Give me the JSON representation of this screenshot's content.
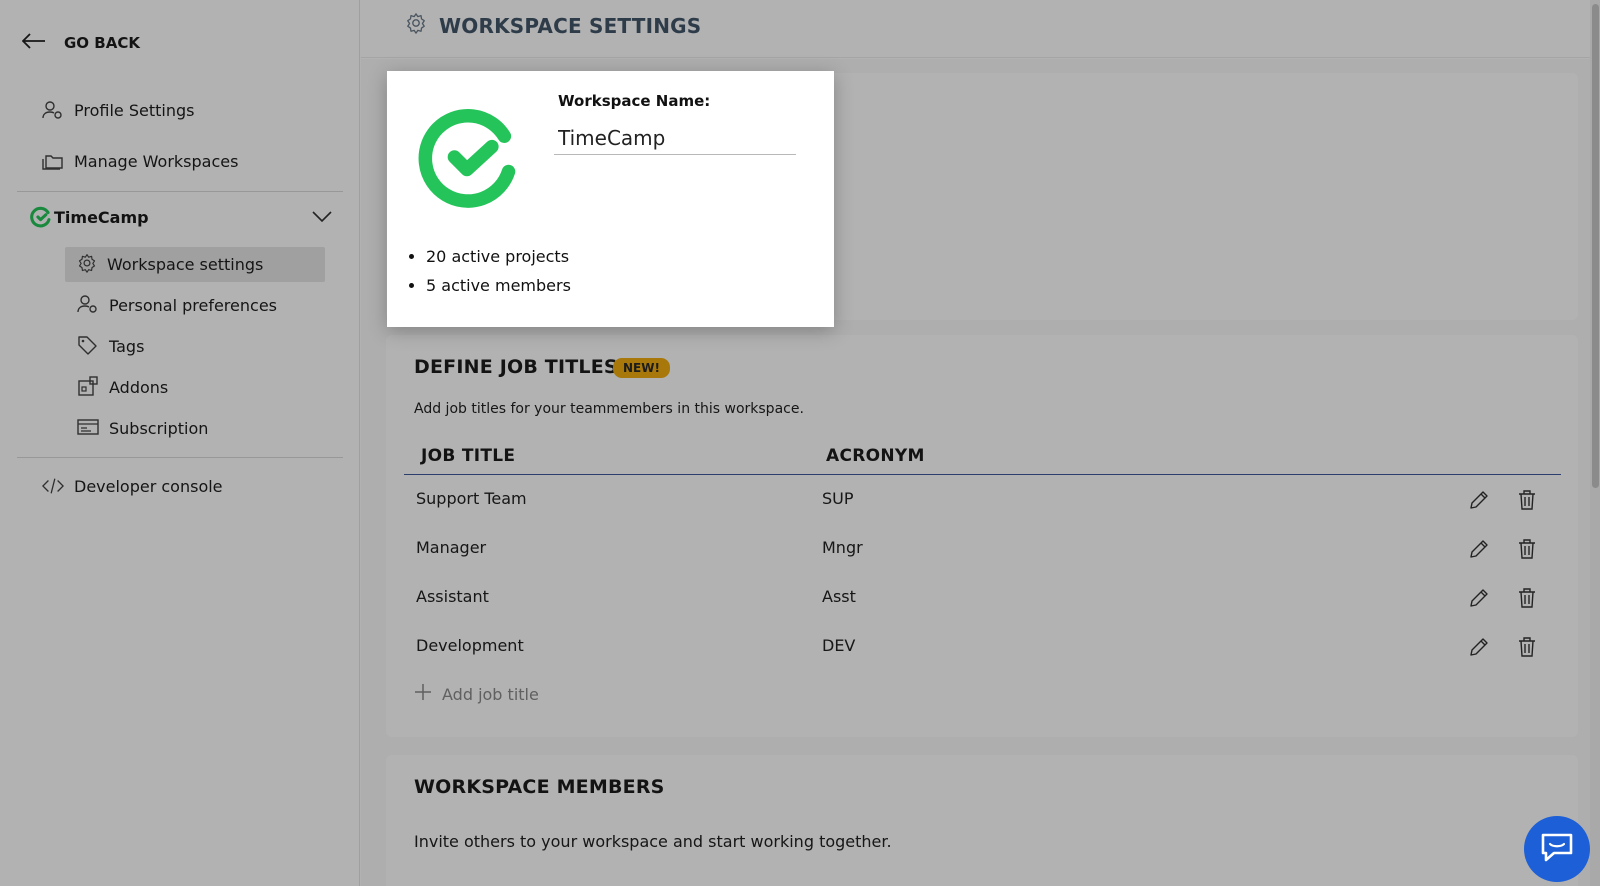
{
  "sidebar": {
    "go_back": "GO BACK",
    "profile_settings": "Profile Settings",
    "manage_workspaces": "Manage Workspaces",
    "workspace_name": "TimeCamp",
    "sub_items": [
      {
        "label": "Workspace settings",
        "icon": "gear-icon",
        "active": true
      },
      {
        "label": "Personal preferences",
        "icon": "user-gear-icon",
        "active": false
      },
      {
        "label": "Tags",
        "icon": "tag-icon",
        "active": false
      },
      {
        "label": "Addons",
        "icon": "addons-icon",
        "active": false
      },
      {
        "label": "Subscription",
        "icon": "card-icon",
        "active": false
      }
    ],
    "developer_console": "Developer console"
  },
  "topbar": {
    "title": "WORKSPACE SETTINGS"
  },
  "job_titles": {
    "title": "DEFINE JOB TITLES",
    "badge": "NEW!",
    "description": "Add job titles for your teammembers in this workspace.",
    "col_title": "JOB TITLE",
    "col_acronym": "ACRONYM",
    "rows": [
      {
        "title": "Support Team",
        "acronym": "SUP"
      },
      {
        "title": "Manager",
        "acronym": "Mngr"
      },
      {
        "title": "Assistant",
        "acronym": "Asst"
      },
      {
        "title": "Development",
        "acronym": "DEV"
      }
    ],
    "add_label": "Add job title"
  },
  "members": {
    "title": "WORKSPACE MEMBERS",
    "description": "Invite others to your workspace and start working together."
  },
  "popup": {
    "label": "Workspace Name:",
    "value": "TimeCamp",
    "stats": [
      "20 active projects",
      "5 active members"
    ]
  },
  "colors": {
    "brand_green": "#25c45a",
    "accent_blue": "#1c5fd6",
    "badge_yellow": "#f2ad10"
  }
}
